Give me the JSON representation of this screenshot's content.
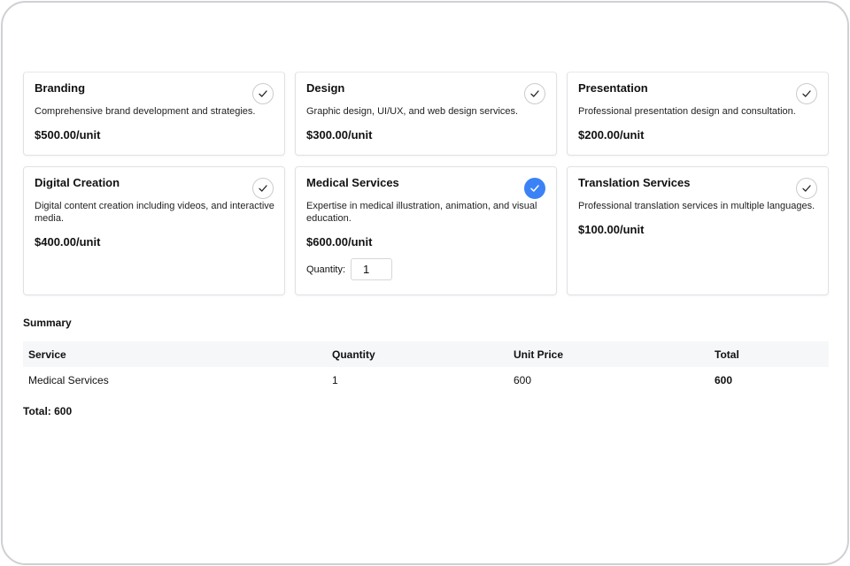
{
  "services": [
    {
      "name": "Branding",
      "description": "Comprehensive brand development and strategies.",
      "price": "$500.00/unit",
      "selected": false
    },
    {
      "name": "Design",
      "description": "Graphic design, UI/UX, and web design services.",
      "price": "$300.00/unit",
      "selected": false
    },
    {
      "name": "Presentation",
      "description": "Professional presentation design and consultation.",
      "price": "$200.00/unit",
      "selected": false
    },
    {
      "name": "Digital Creation",
      "description": "Digital content creation including videos, and interactive media.",
      "price": "$400.00/unit",
      "selected": false
    },
    {
      "name": "Medical Services",
      "description": "Expertise in medical illustration, animation, and visual education.",
      "price": "$600.00/unit",
      "selected": true,
      "quantity_label": "Quantity:",
      "quantity": "1"
    },
    {
      "name": "Translation Services",
      "description": "Professional translation services in multiple languages.",
      "price": "$100.00/unit",
      "selected": false
    }
  ],
  "summary": {
    "title": "Summary",
    "headers": [
      "Service",
      "Quantity",
      "Unit Price",
      "Total"
    ],
    "rows": [
      [
        "Medical Services",
        "1",
        "600",
        "600"
      ]
    ],
    "grand_total": "Total: 600"
  },
  "colors": {
    "accent": "#3b82f6",
    "border": "#dfe1e5",
    "header_bg": "#f6f7f9"
  },
  "icons": {
    "check": "checkmark-icon"
  }
}
